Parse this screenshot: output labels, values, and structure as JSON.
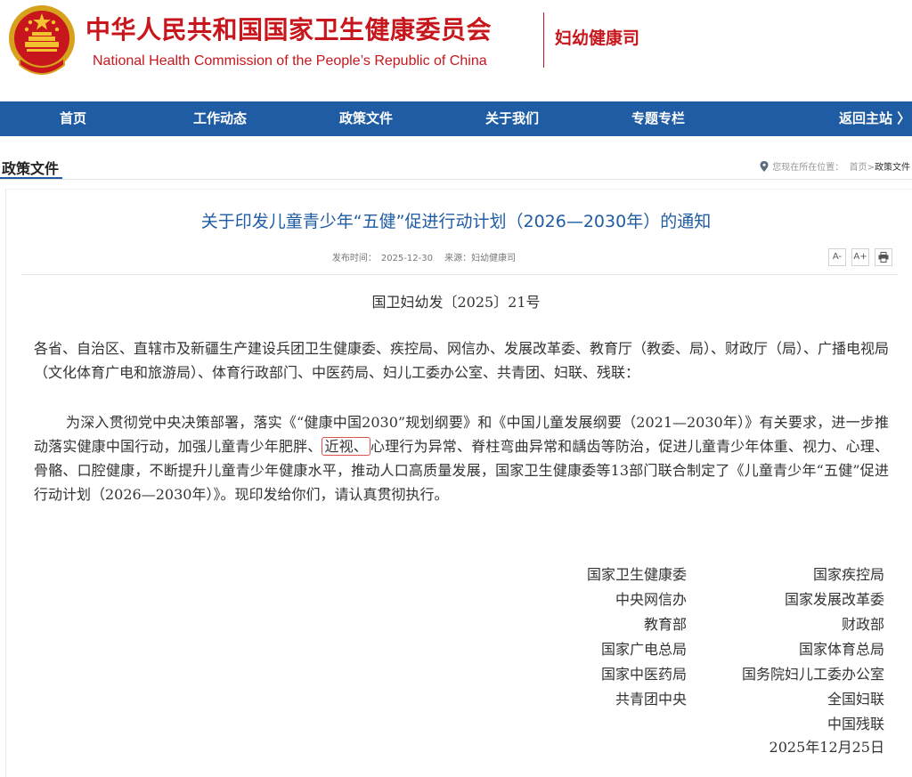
{
  "header": {
    "site_name_cn": "中华人民共和国国家卫生健康委员会",
    "site_name_en": "National Health Commission of the People’s Republic of China",
    "department": "妇幼健康司",
    "emblem_icon": "national-emblem-icon"
  },
  "nav": {
    "items": [
      "首页",
      "工作动态",
      "政策文件",
      "关于我们",
      "专题专栏",
      "返回主站 〉"
    ],
    "active_index": 2,
    "bg_color": "#1f5ca3"
  },
  "section": {
    "title": "政策文件",
    "location_label": "您现在所在位置：",
    "crumb_home": "首页>",
    "crumb_current": "政策文件"
  },
  "article": {
    "title": "关于印发儿童青少年“五健”促进行动计划（2026—2030年）的通知",
    "meta": "发布时间：　2025-12-30　 来源：妇幼健康司",
    "tools": [
      "A-",
      "A+",
      "print-icon"
    ],
    "doc_number": "国卫妇幼发〔2025〕21号",
    "addressees": "各省、自治区、直辖市及新疆生产建设兵团卫生健康委、疾控局、网信办、发展改革委、教育厅（教委、局）、财政厅（局）、广播电视局（文化体育广电和旅游局）、体育行政部门、中医药局、妇儿工委办公室、共青团、妇联、残联：",
    "body_before": "为深入贯彻党中央决策部署，落实《“健康中国2030”规划纲要》和《中国儿童发展纲要（2021—2030年）》有关要求，进一步推动落实健康中国行动，加强儿童青少年肥胖、",
    "body_highlight": "近视、",
    "body_after": "心理行为异常、脊柱弯曲异常和龋齿等防治，促进儿童青少年体重、视力、心理、骨骼、口腔健康，不断提升儿童青少年健康水平，推动人口高质量发展，国家卫生健康委等13部门联合制定了《儿童青少年“五健”促进行动计划（2026—2030年）》。现印发给你们，请认真贯彻执行。",
    "signatories_left": [
      "国家卫生健康委",
      "中央网信办",
      "教育部",
      "国家广电总局",
      "国家中医药局",
      "共青团中央"
    ],
    "signatories_right": [
      "国家疾控局",
      "国家发展改革委",
      "财政部",
      "国家体育总局",
      "国务院妇儿工委办公室",
      "全国妇联",
      "中国残联"
    ],
    "date": "2025年12月25日",
    "highlight_color": "#d9534f"
  }
}
